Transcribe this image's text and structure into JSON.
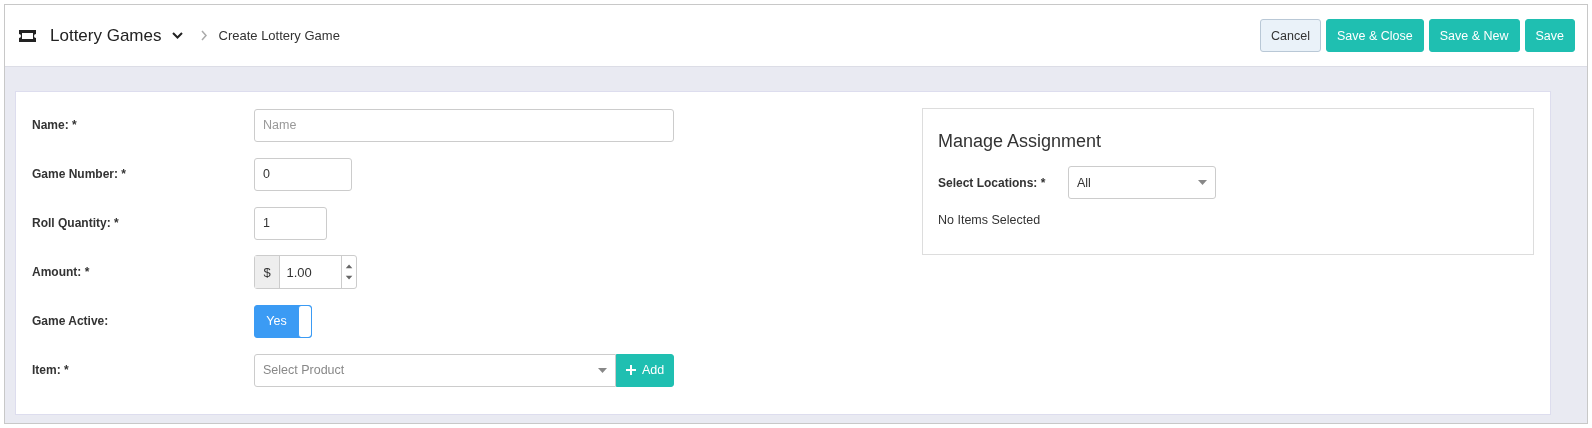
{
  "header": {
    "title": "Lottery Games",
    "crumb": "Create Lottery Game"
  },
  "buttons": [
    {
      "label": "Cancel",
      "kind": "secondary"
    },
    {
      "label": "Save & Close",
      "kind": "primary"
    },
    {
      "label": "Save & New",
      "kind": "primary"
    },
    {
      "label": "Save",
      "kind": "primary"
    }
  ],
  "fields": [
    {
      "label": "Name: *",
      "kind": "text",
      "placeholder": "Name"
    },
    {
      "label": "Game Number: *",
      "kind": "text",
      "value": "0"
    },
    {
      "label": "Roll Quantity: *",
      "kind": "text",
      "value": "1"
    },
    {
      "label": "Amount: *",
      "kind": "currency",
      "prefix": "$",
      "value": "1.00"
    },
    {
      "label": "Game Active:",
      "kind": "toggle",
      "on": true,
      "text": "Yes"
    },
    {
      "label": "Item: *",
      "kind": "select_add",
      "placeholder": "Select Product",
      "button": "Add"
    }
  ],
  "assignment": {
    "title": "Manage Assignment",
    "label": "Select Locations: *",
    "value": "All",
    "empty": "No Items Selected"
  }
}
